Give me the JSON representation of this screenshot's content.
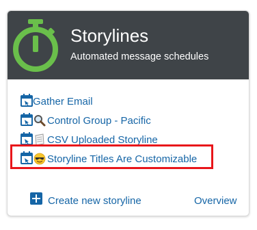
{
  "header": {
    "title": "Storylines",
    "subtitle": "Automated message schedules",
    "icon": "stopwatch-icon",
    "background_color": "#3f4448",
    "icon_color": "#6abf4b"
  },
  "storylines": [
    {
      "label": "Gather Email",
      "icon": "calendar-arrow-icon",
      "emoji": null
    },
    {
      "label": "Control Group - Pacific",
      "icon": "calendar-arrow-icon",
      "emoji": "magnifying-glass-icon"
    },
    {
      "label": "CSV Uploaded Storyline",
      "icon": "calendar-arrow-icon",
      "emoji": "page-icon"
    },
    {
      "label": "Storyline Titles Are Customizable",
      "icon": "calendar-arrow-icon",
      "emoji": "sunglasses-face-icon"
    }
  ],
  "footer": {
    "create_label": "Create new storyline",
    "overview_label": "Overview"
  },
  "colors": {
    "link": "#1565a6",
    "highlight": "#e8151a"
  }
}
